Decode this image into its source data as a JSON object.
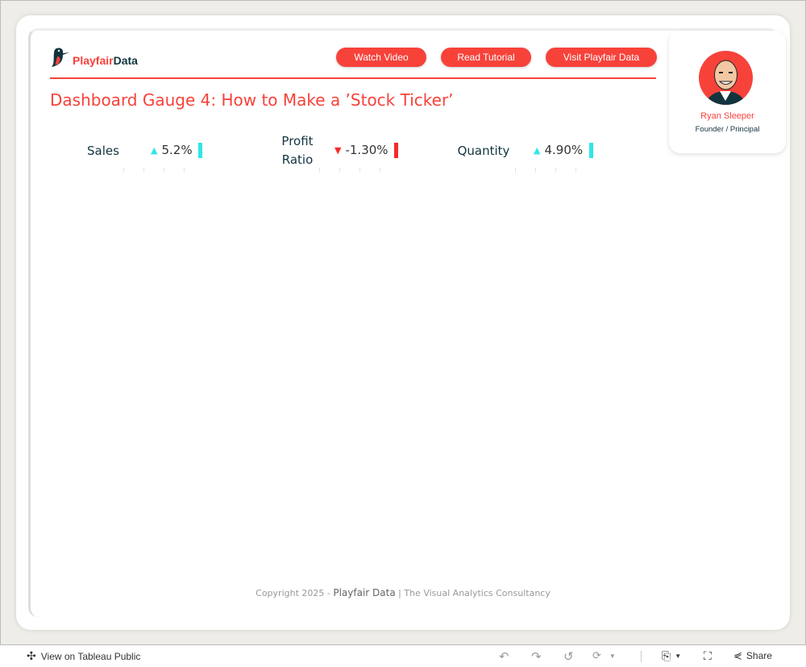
{
  "header": {
    "logo_text_1": "Playfair",
    "logo_text_2": "Data",
    "buttons": [
      "Watch Video",
      "Read Tutorial",
      "Visit Playfair Data"
    ],
    "title": "Dashboard Gauge 4: How to Make a ’Stock Ticker’"
  },
  "kpis": [
    {
      "label_1": "Sales",
      "label_2": "",
      "value": "5.2%",
      "direction": "up",
      "color": "#2ee6e6"
    },
    {
      "label_1": "Profit",
      "label_2": "Ratio",
      "value": "-1.30%",
      "direction": "down",
      "color": "#f72a2a"
    },
    {
      "label_1": "Quantity",
      "label_2": "",
      "value": "4.90%",
      "direction": "up",
      "color": "#2ee6e6"
    }
  ],
  "icons": {
    "up": "▲",
    "down": "▼"
  },
  "profile": {
    "name": "Ryan Sleeper",
    "role": "Founder / Principal"
  },
  "footer": {
    "prefix": "Copyright 2025 - ",
    "brand": "Playfair Data",
    "suffix": " | The Visual Analytics Consultancy"
  },
  "toolbar": {
    "view_label": "View on Tableau Public",
    "share_label": "Share"
  },
  "colors": {
    "accent": "#f7423a",
    "navy": "#12343f"
  }
}
